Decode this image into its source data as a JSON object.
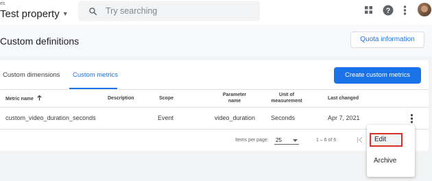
{
  "topbar": {
    "breadcrumb": "es",
    "property_name": "Test property",
    "search_placeholder": "Try searching"
  },
  "page": {
    "title": "Custom definitions",
    "quota_button": "Quota information"
  },
  "tabs": [
    {
      "label": "Custom dimensions",
      "active": false
    },
    {
      "label": "Custom metrics",
      "active": true
    }
  ],
  "create_button": "Create custom metrics",
  "table": {
    "headers": {
      "metric_name": "Metric name",
      "description": "Description",
      "scope": "Scope",
      "parameter_name_1": "Parameter",
      "parameter_name_2": "name",
      "unit_1": "Unit of",
      "unit_2": "measurement",
      "last_changed": "Last changed"
    },
    "rows": [
      {
        "metric_name": "custom_video_duration_seconds",
        "description": "",
        "scope": "Event",
        "parameter_name": "video_duration",
        "unit": "Seconds",
        "last_changed": "Apr 7, 2021"
      }
    ]
  },
  "footer": {
    "items_per_page_label": "Items per page:",
    "items_per_page": "25",
    "range": "1 – 6 of 6"
  },
  "context_menu": {
    "edit": "Edit",
    "archive": "Archive"
  },
  "colors": {
    "accent": "#1a73e8",
    "highlight": "#d93025"
  }
}
